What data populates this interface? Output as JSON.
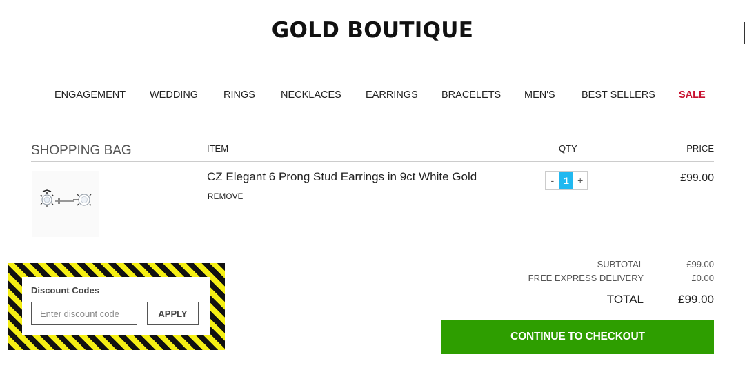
{
  "brand": {
    "name": "GOLD BOUTIQUE"
  },
  "nav": {
    "items": [
      {
        "label": "ENGAGEMENT"
      },
      {
        "label": "WEDDING"
      },
      {
        "label": "RINGS"
      },
      {
        "label": "NECKLACES"
      },
      {
        "label": "EARRINGS"
      },
      {
        "label": "BRACELETS"
      },
      {
        "label": "MEN'S"
      },
      {
        "label": "BEST SELLERS"
      },
      {
        "label": "SALE"
      }
    ],
    "sale_color": "#c8102e"
  },
  "bag": {
    "title": "SHOPPING BAG",
    "columns": {
      "item": "ITEM",
      "qty": "QTY",
      "price": "PRICE"
    },
    "items": [
      {
        "name": "CZ Elegant 6 Prong Stud Earrings in 9ct White Gold",
        "remove_label": "REMOVE",
        "qty_minus": "-",
        "qty": "1",
        "qty_plus": "+",
        "price": "£99.00",
        "image_icon": "stud-earrings-icon"
      }
    ]
  },
  "summary": {
    "subtotal_label": "SUBTOTAL",
    "subtotal_value": "£99.00",
    "delivery_label": "FREE EXPRESS DELIVERY",
    "delivery_value": "£0.00",
    "total_label": "TOTAL",
    "total_value": "£99.00",
    "checkout_label": "CONTINUE TO CHECKOUT",
    "checkout_color": "#2e9e00"
  },
  "discount": {
    "title": "Discount Codes",
    "placeholder": "Enter discount code",
    "value": "",
    "apply_label": "APPLY"
  },
  "colors": {
    "qty_accent": "#21b8f0",
    "hazard_black": "#111111",
    "hazard_yellow": "#f5ef14"
  }
}
